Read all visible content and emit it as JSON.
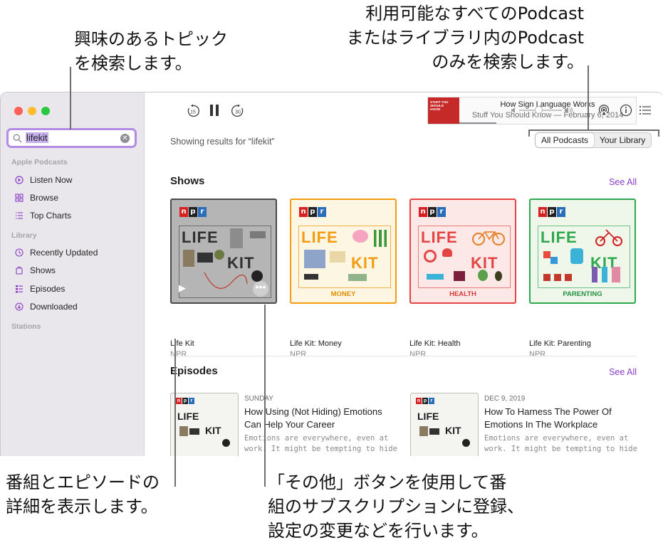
{
  "callouts": {
    "search_line1": "興味のあるトピック",
    "search_line2": "を検索します。",
    "scope_line1": "利用可能なすべてのPodcast",
    "scope_line2": "またはライブラリ内のPodcast",
    "scope_line3": "のみを検索します。",
    "details_line1": "番組とエピソードの",
    "details_line2": "詳細を表示します。",
    "more_line1": "「その他」ボタンを使用して番",
    "more_line2": "組のサブスクリプションに登録、",
    "more_line3": "設定の変更などを行います。"
  },
  "sidebar": {
    "search_value": "lifekit",
    "section_apple": "Apple Podcasts",
    "items_apple": [
      {
        "label": "Listen Now",
        "icon": "play-circle-icon"
      },
      {
        "label": "Browse",
        "icon": "grid-icon"
      },
      {
        "label": "Top Charts",
        "icon": "list-icon"
      }
    ],
    "section_library": "Library",
    "items_library": [
      {
        "label": "Recently Updated",
        "icon": "clock-icon"
      },
      {
        "label": "Shows",
        "icon": "podcast-stack-icon"
      },
      {
        "label": "Episodes",
        "icon": "episodes-list-icon"
      },
      {
        "label": "Downloaded",
        "icon": "download-icon"
      }
    ],
    "section_stations": "Stations"
  },
  "player": {
    "skip_back": "15",
    "skip_forward": "30",
    "title": "How Sign Language Works",
    "subtitle": "Stuff You Should Know — February 6, 2014",
    "art_text": "STUFF YOU SHOULD KNOW",
    "progress": 0.21,
    "volume": 0.45
  },
  "results": {
    "label": "Showing results for “lifekit”",
    "scope_all": "All Podcasts",
    "scope_library": "Your Library"
  },
  "shows": {
    "heading": "Shows",
    "see_all": "See All",
    "npr_letters": [
      "n",
      "p",
      "r"
    ],
    "life_word": "LIFE",
    "kit_word": "KIT",
    "cards": [
      {
        "title": "Life Kit",
        "subtitle": "NPR",
        "category": "",
        "color": "#5b5b5b"
      },
      {
        "title": "Life Kit: Money",
        "subtitle": "NPR",
        "category": "MONEY",
        "color": "#f39c12"
      },
      {
        "title": "Life Kit: Health",
        "subtitle": "NPR",
        "category": "HEALTH",
        "color": "#e34545"
      },
      {
        "title": "Life Kit: Parenting",
        "subtitle": "NPR",
        "category": "PARENTING",
        "color": "#2fa84f"
      }
    ]
  },
  "episodes": {
    "heading": "Episodes",
    "see_all": "See All",
    "items": [
      {
        "date": "SUNDAY",
        "title": "How Using (Not Hiding) Emotions Can Help Your Career",
        "desc": "Emotions are everywhere, even at work. It might be tempting to hide them — but y..."
      },
      {
        "date": "DEC 9, 2019",
        "title": "How To Harness The Power Of Emotions In The Workplace",
        "desc": "Emotions are everywhere, even at work. It might be tempting to hide them — but y..."
      }
    ]
  },
  "colors": {
    "accent": "#8a3ac7",
    "search_border": "#b48be4",
    "npr_red": "#d62021",
    "npr_black": "#222222",
    "npr_blue": "#2a6ebb"
  }
}
